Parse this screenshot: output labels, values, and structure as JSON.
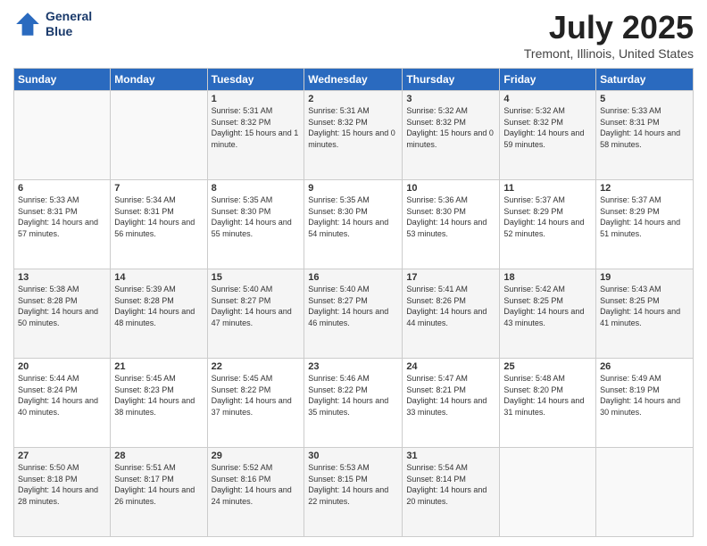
{
  "header": {
    "logo_line1": "General",
    "logo_line2": "Blue",
    "title": "July 2025",
    "subtitle": "Tremont, Illinois, United States"
  },
  "weekdays": [
    "Sunday",
    "Monday",
    "Tuesday",
    "Wednesday",
    "Thursday",
    "Friday",
    "Saturday"
  ],
  "weeks": [
    [
      {
        "day": "",
        "sunrise": "",
        "sunset": "",
        "daylight": ""
      },
      {
        "day": "",
        "sunrise": "",
        "sunset": "",
        "daylight": ""
      },
      {
        "day": "1",
        "sunrise": "Sunrise: 5:31 AM",
        "sunset": "Sunset: 8:32 PM",
        "daylight": "Daylight: 15 hours and 1 minute."
      },
      {
        "day": "2",
        "sunrise": "Sunrise: 5:31 AM",
        "sunset": "Sunset: 8:32 PM",
        "daylight": "Daylight: 15 hours and 0 minutes."
      },
      {
        "day": "3",
        "sunrise": "Sunrise: 5:32 AM",
        "sunset": "Sunset: 8:32 PM",
        "daylight": "Daylight: 15 hours and 0 minutes."
      },
      {
        "day": "4",
        "sunrise": "Sunrise: 5:32 AM",
        "sunset": "Sunset: 8:32 PM",
        "daylight": "Daylight: 14 hours and 59 minutes."
      },
      {
        "day": "5",
        "sunrise": "Sunrise: 5:33 AM",
        "sunset": "Sunset: 8:31 PM",
        "daylight": "Daylight: 14 hours and 58 minutes."
      }
    ],
    [
      {
        "day": "6",
        "sunrise": "Sunrise: 5:33 AM",
        "sunset": "Sunset: 8:31 PM",
        "daylight": "Daylight: 14 hours and 57 minutes."
      },
      {
        "day": "7",
        "sunrise": "Sunrise: 5:34 AM",
        "sunset": "Sunset: 8:31 PM",
        "daylight": "Daylight: 14 hours and 56 minutes."
      },
      {
        "day": "8",
        "sunrise": "Sunrise: 5:35 AM",
        "sunset": "Sunset: 8:30 PM",
        "daylight": "Daylight: 14 hours and 55 minutes."
      },
      {
        "day": "9",
        "sunrise": "Sunrise: 5:35 AM",
        "sunset": "Sunset: 8:30 PM",
        "daylight": "Daylight: 14 hours and 54 minutes."
      },
      {
        "day": "10",
        "sunrise": "Sunrise: 5:36 AM",
        "sunset": "Sunset: 8:30 PM",
        "daylight": "Daylight: 14 hours and 53 minutes."
      },
      {
        "day": "11",
        "sunrise": "Sunrise: 5:37 AM",
        "sunset": "Sunset: 8:29 PM",
        "daylight": "Daylight: 14 hours and 52 minutes."
      },
      {
        "day": "12",
        "sunrise": "Sunrise: 5:37 AM",
        "sunset": "Sunset: 8:29 PM",
        "daylight": "Daylight: 14 hours and 51 minutes."
      }
    ],
    [
      {
        "day": "13",
        "sunrise": "Sunrise: 5:38 AM",
        "sunset": "Sunset: 8:28 PM",
        "daylight": "Daylight: 14 hours and 50 minutes."
      },
      {
        "day": "14",
        "sunrise": "Sunrise: 5:39 AM",
        "sunset": "Sunset: 8:28 PM",
        "daylight": "Daylight: 14 hours and 48 minutes."
      },
      {
        "day": "15",
        "sunrise": "Sunrise: 5:40 AM",
        "sunset": "Sunset: 8:27 PM",
        "daylight": "Daylight: 14 hours and 47 minutes."
      },
      {
        "day": "16",
        "sunrise": "Sunrise: 5:40 AM",
        "sunset": "Sunset: 8:27 PM",
        "daylight": "Daylight: 14 hours and 46 minutes."
      },
      {
        "day": "17",
        "sunrise": "Sunrise: 5:41 AM",
        "sunset": "Sunset: 8:26 PM",
        "daylight": "Daylight: 14 hours and 44 minutes."
      },
      {
        "day": "18",
        "sunrise": "Sunrise: 5:42 AM",
        "sunset": "Sunset: 8:25 PM",
        "daylight": "Daylight: 14 hours and 43 minutes."
      },
      {
        "day": "19",
        "sunrise": "Sunrise: 5:43 AM",
        "sunset": "Sunset: 8:25 PM",
        "daylight": "Daylight: 14 hours and 41 minutes."
      }
    ],
    [
      {
        "day": "20",
        "sunrise": "Sunrise: 5:44 AM",
        "sunset": "Sunset: 8:24 PM",
        "daylight": "Daylight: 14 hours and 40 minutes."
      },
      {
        "day": "21",
        "sunrise": "Sunrise: 5:45 AM",
        "sunset": "Sunset: 8:23 PM",
        "daylight": "Daylight: 14 hours and 38 minutes."
      },
      {
        "day": "22",
        "sunrise": "Sunrise: 5:45 AM",
        "sunset": "Sunset: 8:22 PM",
        "daylight": "Daylight: 14 hours and 37 minutes."
      },
      {
        "day": "23",
        "sunrise": "Sunrise: 5:46 AM",
        "sunset": "Sunset: 8:22 PM",
        "daylight": "Daylight: 14 hours and 35 minutes."
      },
      {
        "day": "24",
        "sunrise": "Sunrise: 5:47 AM",
        "sunset": "Sunset: 8:21 PM",
        "daylight": "Daylight: 14 hours and 33 minutes."
      },
      {
        "day": "25",
        "sunrise": "Sunrise: 5:48 AM",
        "sunset": "Sunset: 8:20 PM",
        "daylight": "Daylight: 14 hours and 31 minutes."
      },
      {
        "day": "26",
        "sunrise": "Sunrise: 5:49 AM",
        "sunset": "Sunset: 8:19 PM",
        "daylight": "Daylight: 14 hours and 30 minutes."
      }
    ],
    [
      {
        "day": "27",
        "sunrise": "Sunrise: 5:50 AM",
        "sunset": "Sunset: 8:18 PM",
        "daylight": "Daylight: 14 hours and 28 minutes."
      },
      {
        "day": "28",
        "sunrise": "Sunrise: 5:51 AM",
        "sunset": "Sunset: 8:17 PM",
        "daylight": "Daylight: 14 hours and 26 minutes."
      },
      {
        "day": "29",
        "sunrise": "Sunrise: 5:52 AM",
        "sunset": "Sunset: 8:16 PM",
        "daylight": "Daylight: 14 hours and 24 minutes."
      },
      {
        "day": "30",
        "sunrise": "Sunrise: 5:53 AM",
        "sunset": "Sunset: 8:15 PM",
        "daylight": "Daylight: 14 hours and 22 minutes."
      },
      {
        "day": "31",
        "sunrise": "Sunrise: 5:54 AM",
        "sunset": "Sunset: 8:14 PM",
        "daylight": "Daylight: 14 hours and 20 minutes."
      },
      {
        "day": "",
        "sunrise": "",
        "sunset": "",
        "daylight": ""
      },
      {
        "day": "",
        "sunrise": "",
        "sunset": "",
        "daylight": ""
      }
    ]
  ]
}
